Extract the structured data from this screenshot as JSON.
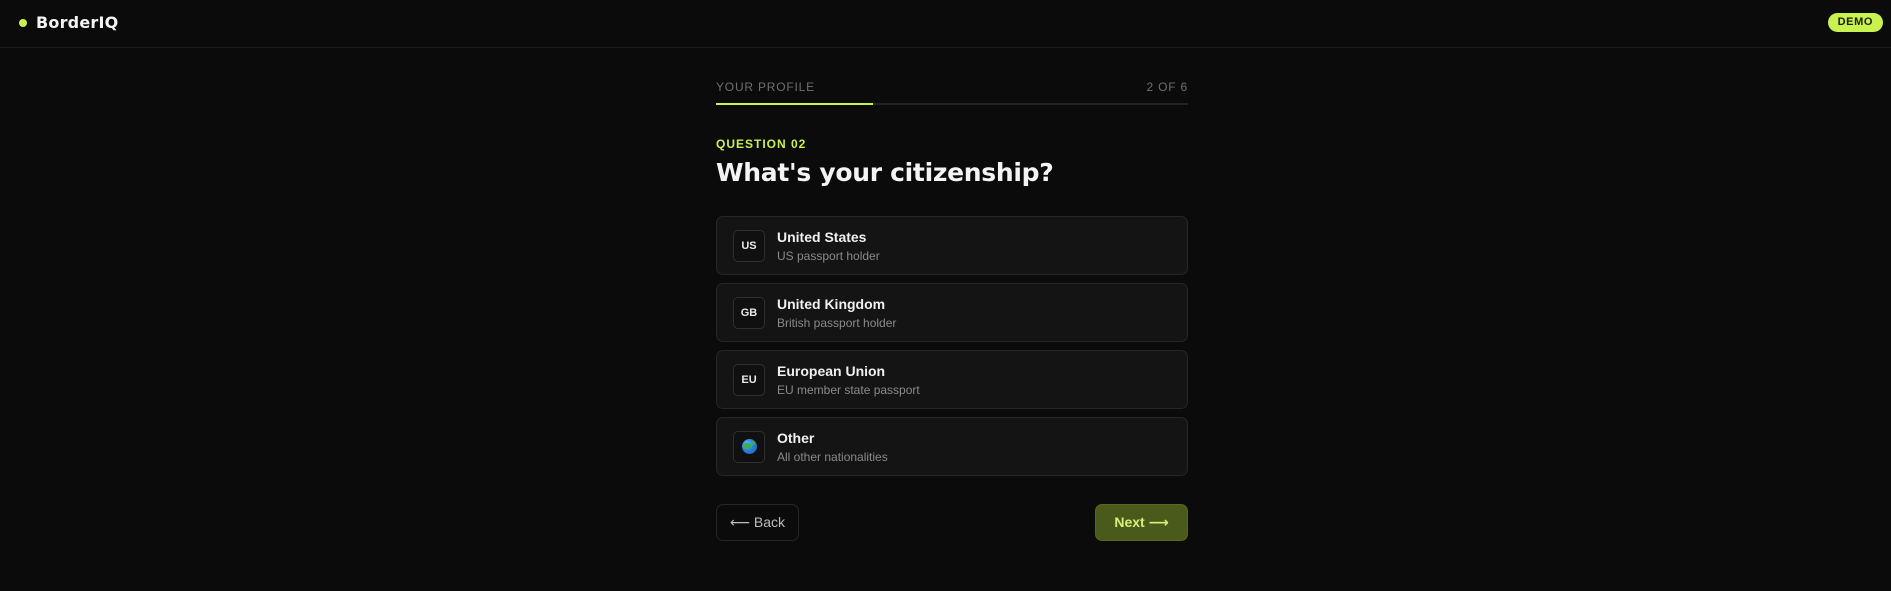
{
  "brand": {
    "name": "BorderIQ",
    "badge": "DEMO",
    "accent": "#c8f250"
  },
  "progress": {
    "section": "YOUR PROFILE",
    "step": "2 OF 6",
    "fraction": 0.3333
  },
  "question": {
    "label": "QUESTION 02",
    "title": "What's your citizenship?"
  },
  "options": [
    {
      "code": "US",
      "title": "United States",
      "subtitle": "US passport holder"
    },
    {
      "code": "GB",
      "title": "United Kingdom",
      "subtitle": "British passport holder"
    },
    {
      "code": "EU",
      "title": "European Union",
      "subtitle": "EU member state passport"
    },
    {
      "icon": "globe-icon",
      "title": "Other",
      "subtitle": "All other nationalities"
    }
  ],
  "nav": {
    "back_label": "⟵ Back",
    "next_label": "Next ⟶"
  }
}
